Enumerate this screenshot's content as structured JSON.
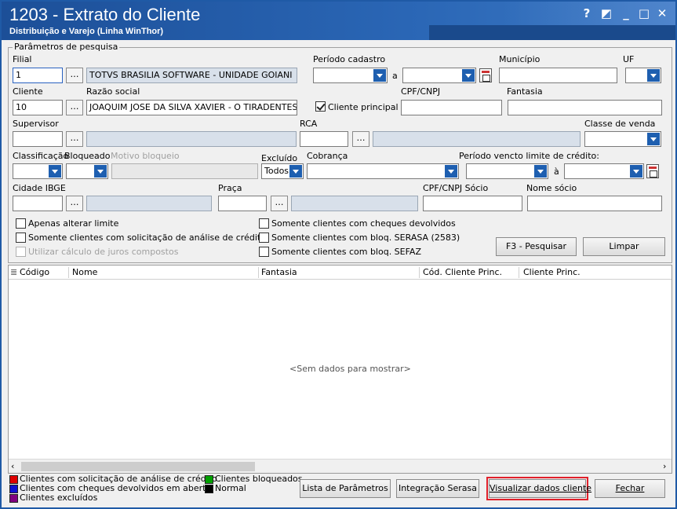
{
  "window": {
    "title": "1203 - Extrato do Cliente",
    "subtitle": "Distribuição e Varejo (Linha WinThor)",
    "buttons": {
      "help": "?",
      "restore": "◩",
      "minimize": "_",
      "maximize": "□",
      "close": "✕"
    }
  },
  "params": {
    "group_title": "Parâmetros de pesquisa",
    "filial": {
      "label": "Filial",
      "value": "1",
      "name": "TOTVS BRASILIA SOFTWARE - UNIDADE GOIANI"
    },
    "periodo_cadastro": {
      "label": "Período cadastro",
      "sep": "a",
      "from": "",
      "to": ""
    },
    "municipio": {
      "label": "Município",
      "value": ""
    },
    "uf": {
      "label": "UF",
      "value": ""
    },
    "cliente": {
      "label": "Cliente",
      "value": "10"
    },
    "razao_social": {
      "label": "Razão social",
      "value": "JOAQUIM JOSE DA SILVA XAVIER - O TIRADENTES"
    },
    "cliente_principal": {
      "label": "Cliente principal",
      "checked": true
    },
    "cpf_cnpj": {
      "label": "CPF/CNPJ",
      "value": ""
    },
    "fantasia": {
      "label": "Fantasia",
      "value": ""
    },
    "supervisor": {
      "label": "Supervisor",
      "value": ""
    },
    "rca": {
      "label": "RCA",
      "value": ""
    },
    "classe_venda": {
      "label": "Classe de venda",
      "value": ""
    },
    "classificacao": {
      "label": "Classificação",
      "value": ""
    },
    "bloqueado": {
      "label": "Bloqueado",
      "value": ""
    },
    "motivo_bloqueio": {
      "label": "Motivo bloqueio",
      "value": ""
    },
    "excluido": {
      "label": "Excluído",
      "value": "Todos"
    },
    "cobranca": {
      "label": "Cobrança",
      "value": ""
    },
    "periodo_vencto": {
      "label": "Período vencto limite de crédito:",
      "sep": "à"
    },
    "cidade_ibge": {
      "label": "Cidade IBGE",
      "value": ""
    },
    "praca": {
      "label": "Praça",
      "value": ""
    },
    "cpf_cnpj_socio": {
      "label": "CPF/CNPJ Sócio",
      "value": ""
    },
    "nome_socio": {
      "label": "Nome sócio",
      "value": ""
    },
    "checks": {
      "apenas_alterar_limite": "Apenas alterar limite",
      "somente_solicitacao": "Somente clientes com solicitação de análise de crédito",
      "utilizar_calculo": "Utilizar cálculo de juros compostos",
      "somente_cheques": "Somente clientes com cheques devolvidos",
      "somente_serasa": "Somente clientes com bloq. SERASA (2583)",
      "somente_sefaz": "Somente clientes com bloq. SEFAZ"
    },
    "btn_pesquisar": "F3 - Pesquisar",
    "btn_limpar": "Limpar"
  },
  "grid": {
    "columns": [
      "Código",
      "Nome",
      "Fantasia",
      "Cód. Cliente Princ.",
      "Cliente Princ."
    ],
    "empty_text": "<Sem dados para mostrar>"
  },
  "legend": {
    "items": [
      {
        "label": "Clientes com solicitação de análise de crédito",
        "color": "#e00000"
      },
      {
        "label": "Clientes com cheques devolvidos em aberto",
        "color": "#1010d0"
      },
      {
        "label": "Clientes excluídos",
        "color": "#800080"
      },
      {
        "label": "Clientes bloqueados",
        "color": "#00a000"
      },
      {
        "label": "Normal",
        "color": "#000000"
      }
    ]
  },
  "footer": {
    "lista_parametros": "Lista de Parâmetros",
    "integracao_serasa": "Integração Serasa",
    "visualizar_dados": "Visualizar dados cliente",
    "fechar": "Fechar"
  },
  "colors": {
    "accent": "#1e5fb0",
    "highlight": "#e0202a"
  }
}
